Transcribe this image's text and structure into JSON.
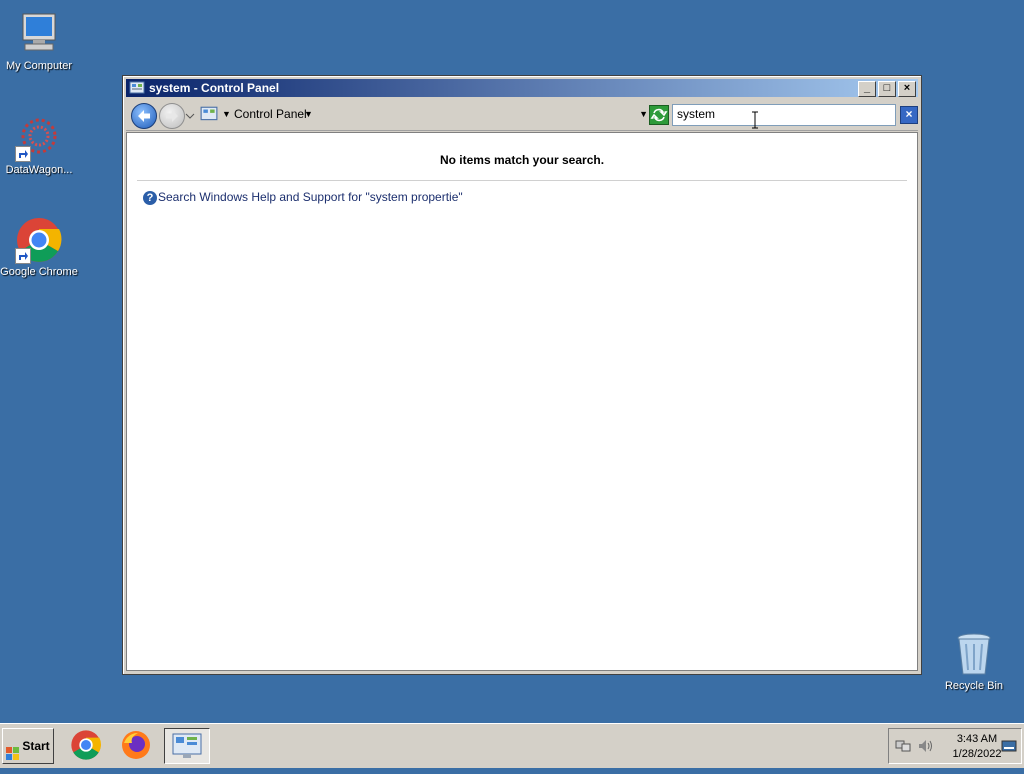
{
  "desktop": {
    "icons": [
      {
        "label": "My Computer"
      },
      {
        "label": "DataWagon..."
      },
      {
        "label": "Google Chrome"
      },
      {
        "label": "Recycle Bin"
      }
    ]
  },
  "window": {
    "title": "system - Control Panel",
    "breadcrumb": "Control Panel",
    "search_value": "system ",
    "no_items_text": "No items match your search.",
    "help_link_text": "Search Windows Help and Support for \"system propertie\""
  },
  "taskbar": {
    "start_label": "Start",
    "clock_time": "3:43 AM",
    "clock_date": "1/28/2022"
  },
  "colors": {
    "desktop_bg": "#3a6ea5",
    "titlebar_start": "#0a246a",
    "titlebar_end": "#a6caf0"
  }
}
